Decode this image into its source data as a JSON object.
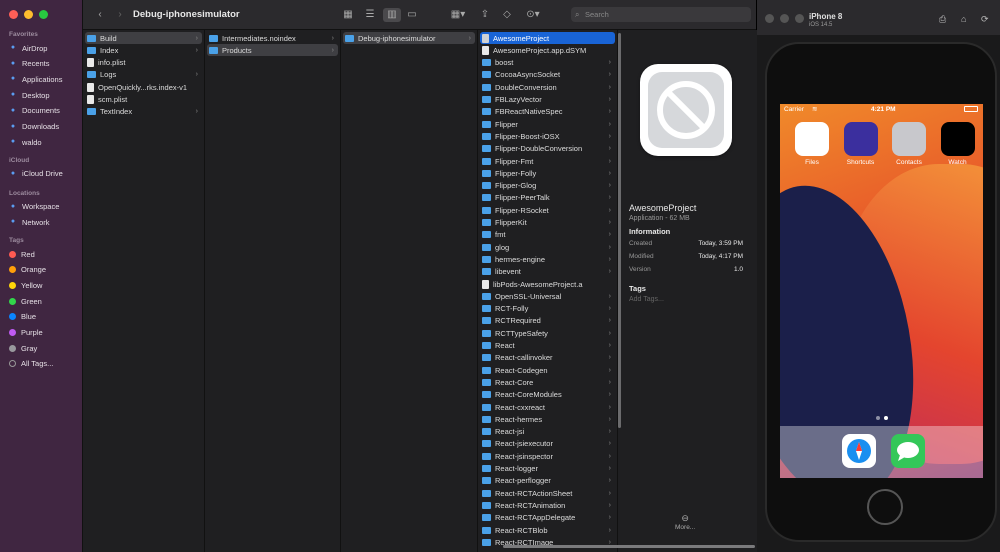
{
  "finder": {
    "title": "Debug-iphonesimulator",
    "search_placeholder": "Search",
    "sidebar": {
      "favorites_label": "Favorites",
      "favorites": [
        {
          "label": "AirDrop",
          "icon": "airdrop-icon"
        },
        {
          "label": "Recents",
          "icon": "clock-icon"
        },
        {
          "label": "Applications",
          "icon": "applications-icon"
        },
        {
          "label": "Desktop",
          "icon": "desktop-icon"
        },
        {
          "label": "Documents",
          "icon": "document-icon"
        },
        {
          "label": "Downloads",
          "icon": "download-icon"
        },
        {
          "label": "waldo",
          "icon": "home-icon"
        }
      ],
      "icloud_label": "iCloud",
      "icloud": [
        {
          "label": "iCloud Drive",
          "icon": "cloud-icon"
        }
      ],
      "locations_label": "Locations",
      "locations": [
        {
          "label": "Workspace",
          "icon": "disk-icon"
        },
        {
          "label": "Network",
          "icon": "globe-icon"
        }
      ],
      "tags_label": "Tags",
      "tags": [
        {
          "label": "Red",
          "color": "#ff5a52"
        },
        {
          "label": "Orange",
          "color": "#ff9f0a"
        },
        {
          "label": "Yellow",
          "color": "#ffd60a"
        },
        {
          "label": "Green",
          "color": "#32d74b"
        },
        {
          "label": "Blue",
          "color": "#0a84ff"
        },
        {
          "label": "Purple",
          "color": "#bf5af2"
        },
        {
          "label": "Gray",
          "color": "#98989d"
        },
        {
          "label": "All Tags...",
          "color": ""
        }
      ]
    },
    "col1": [
      {
        "label": "Build",
        "type": "folder",
        "chev": true,
        "selected": true
      },
      {
        "label": "Index",
        "type": "folder",
        "chev": true
      },
      {
        "label": "info.plist",
        "type": "file"
      },
      {
        "label": "Logs",
        "type": "folder",
        "chev": true
      },
      {
        "label": "OpenQuickly...rks.index-v1",
        "type": "file"
      },
      {
        "label": "scm.plist",
        "type": "file"
      },
      {
        "label": "TextIndex",
        "type": "folder",
        "chev": true
      }
    ],
    "col2": [
      {
        "label": "Intermediates.noindex",
        "type": "folder",
        "chev": true
      },
      {
        "label": "Products",
        "type": "folder",
        "chev": true,
        "selected": true
      }
    ],
    "col3": [
      {
        "label": "Debug-iphonesimulator",
        "type": "folder",
        "chev": true,
        "selected": true
      }
    ],
    "col4": [
      {
        "label": "AwesomeProject",
        "type": "app",
        "active": true
      },
      {
        "label": "AwesomeProject.app.dSYM",
        "type": "file"
      },
      {
        "label": "boost",
        "type": "folder",
        "chev": true
      },
      {
        "label": "CocoaAsyncSocket",
        "type": "folder",
        "chev": true
      },
      {
        "label": "DoubleConversion",
        "type": "folder",
        "chev": true
      },
      {
        "label": "FBLazyVector",
        "type": "folder",
        "chev": true
      },
      {
        "label": "FBReactNativeSpec",
        "type": "folder",
        "chev": true
      },
      {
        "label": "Flipper",
        "type": "folder",
        "chev": true
      },
      {
        "label": "Flipper-Boost-iOSX",
        "type": "folder",
        "chev": true
      },
      {
        "label": "Flipper-DoubleConversion",
        "type": "folder",
        "chev": true
      },
      {
        "label": "Flipper-Fmt",
        "type": "folder",
        "chev": true
      },
      {
        "label": "Flipper-Folly",
        "type": "folder",
        "chev": true
      },
      {
        "label": "Flipper-Glog",
        "type": "folder",
        "chev": true
      },
      {
        "label": "Flipper-PeerTalk",
        "type": "folder",
        "chev": true
      },
      {
        "label": "Flipper-RSocket",
        "type": "folder",
        "chev": true
      },
      {
        "label": "FlipperKit",
        "type": "folder",
        "chev": true
      },
      {
        "label": "fmt",
        "type": "folder",
        "chev": true
      },
      {
        "label": "glog",
        "type": "folder",
        "chev": true
      },
      {
        "label": "hermes-engine",
        "type": "folder",
        "chev": true
      },
      {
        "label": "libevent",
        "type": "folder",
        "chev": true
      },
      {
        "label": "libPods-AwesomeProject.a",
        "type": "file"
      },
      {
        "label": "OpenSSL-Universal",
        "type": "folder",
        "chev": true
      },
      {
        "label": "RCT-Folly",
        "type": "folder",
        "chev": true
      },
      {
        "label": "RCTRequired",
        "type": "folder",
        "chev": true
      },
      {
        "label": "RCTTypeSafety",
        "type": "folder",
        "chev": true
      },
      {
        "label": "React",
        "type": "folder",
        "chev": true
      },
      {
        "label": "React-callinvoker",
        "type": "folder",
        "chev": true
      },
      {
        "label": "React-Codegen",
        "type": "folder",
        "chev": true
      },
      {
        "label": "React-Core",
        "type": "folder",
        "chev": true
      },
      {
        "label": "React-CoreModules",
        "type": "folder",
        "chev": true
      },
      {
        "label": "React-cxxreact",
        "type": "folder",
        "chev": true
      },
      {
        "label": "React-hermes",
        "type": "folder",
        "chev": true
      },
      {
        "label": "React-jsi",
        "type": "folder",
        "chev": true
      },
      {
        "label": "React-jsiexecutor",
        "type": "folder",
        "chev": true
      },
      {
        "label": "React-jsinspector",
        "type": "folder",
        "chev": true
      },
      {
        "label": "React-logger",
        "type": "folder",
        "chev": true
      },
      {
        "label": "React-perflogger",
        "type": "folder",
        "chev": true
      },
      {
        "label": "React-RCTActionSheet",
        "type": "folder",
        "chev": true
      },
      {
        "label": "React-RCTAnimation",
        "type": "folder",
        "chev": true
      },
      {
        "label": "React-RCTAppDelegate",
        "type": "folder",
        "chev": true
      },
      {
        "label": "React-RCTBlob",
        "type": "folder",
        "chev": true
      },
      {
        "label": "React-RCTImage",
        "type": "folder",
        "chev": true
      }
    ],
    "preview": {
      "name": "AwesomeProject",
      "kind": "Application - 62 MB",
      "info_heading": "Information",
      "created_label": "Created",
      "created_value": "Today, 3:59 PM",
      "modified_label": "Modified",
      "modified_value": "Today, 4:17 PM",
      "version_label": "Version",
      "version_value": "1.0",
      "tags_heading": "Tags",
      "tags_placeholder": "Add Tags...",
      "more_label": "More..."
    }
  },
  "simulator": {
    "device": "iPhone 8",
    "os": "iOS 14.5",
    "carrier": "Carrier",
    "time": "4:21 PM",
    "apps": [
      {
        "label": "Files",
        "color": "#ffffff"
      },
      {
        "label": "Shortcuts",
        "color": "#3b2f9e"
      },
      {
        "label": "Contacts",
        "color": "#c8c8cc"
      },
      {
        "label": "Watch",
        "color": "#000000"
      }
    ],
    "dock": [
      {
        "name": "safari",
        "color": "#ffffff"
      },
      {
        "name": "messages",
        "color": "#34c759"
      }
    ]
  }
}
